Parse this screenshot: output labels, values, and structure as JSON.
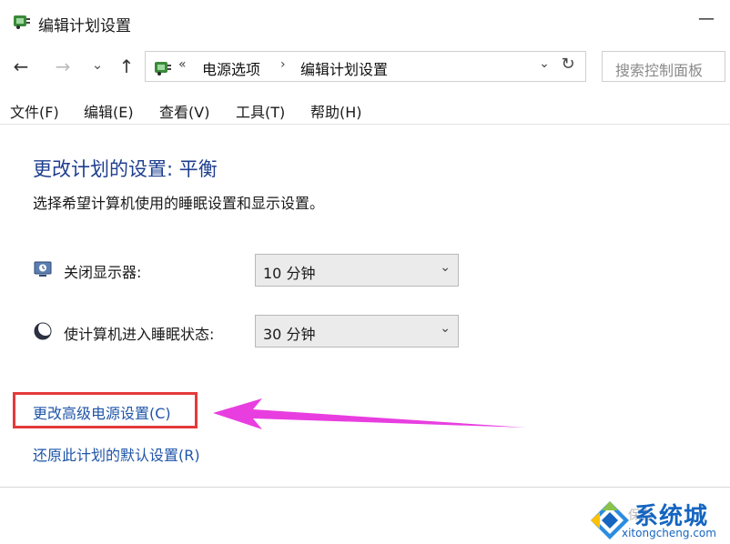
{
  "window": {
    "title": "编辑计划设置",
    "minimize_glyph": "—"
  },
  "nav": {
    "back_glyph": "←",
    "forward_glyph": "→",
    "recent_glyph": "⌄",
    "up_glyph": "↑",
    "breadcrumb_sep": "«",
    "breadcrumb": [
      "电源选项",
      "编辑计划设置"
    ],
    "breadcrumb_arrow": "›",
    "dropdown_glyph": "⌄",
    "refresh_glyph": "↻"
  },
  "search": {
    "placeholder": "搜索控制面板"
  },
  "menubar": {
    "items": [
      "文件(F)",
      "编辑(E)",
      "查看(V)",
      "工具(T)",
      "帮助(H)"
    ]
  },
  "main": {
    "heading": "更改计划的设置: 平衡",
    "subtext": "选择希望计算机使用的睡眠设置和显示设置。",
    "display_off": {
      "label": "关闭显示器:",
      "value": "10 分钟",
      "icon": "monitor-icon"
    },
    "sleep": {
      "label": "使计算机进入睡眠状态:",
      "value": "30 分钟",
      "icon": "moon-icon"
    },
    "select_chevron": "⌄",
    "advanced_link": "更改高级电源设置(C)",
    "restore_link": "还原此计划的默认设置(R)"
  },
  "annotation": {
    "highlight_color": "#e53a3a",
    "arrow_color": "#e83ee0"
  },
  "watermark": {
    "brand": "系统城",
    "url": "xitongcheng.com"
  },
  "colors": {
    "heading": "#1e3f8f",
    "link": "#1f55a8"
  }
}
